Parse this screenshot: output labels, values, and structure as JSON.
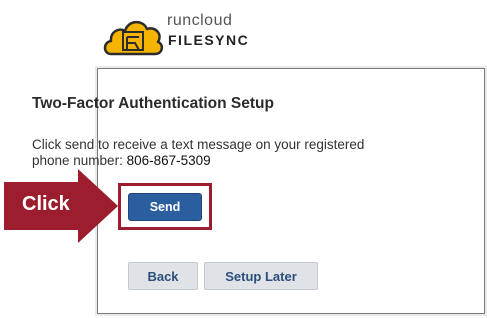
{
  "logo": {
    "brand_word": "runcloud",
    "product_word": "FILESYNC",
    "colors": {
      "cloud": "#f5b400",
      "outline": "#2c2c2c"
    }
  },
  "dialog": {
    "title": "Two-Factor Authentication Setup",
    "body_text": "Click send to receive a text message on your registered phone number:",
    "phone_number": "806-867-5309"
  },
  "buttons": {
    "send_label": "Send",
    "back_label": "Back",
    "setup_later_label": "Setup Later"
  },
  "annotation": {
    "callout_label": "Click",
    "color": "#9b1d2e"
  }
}
